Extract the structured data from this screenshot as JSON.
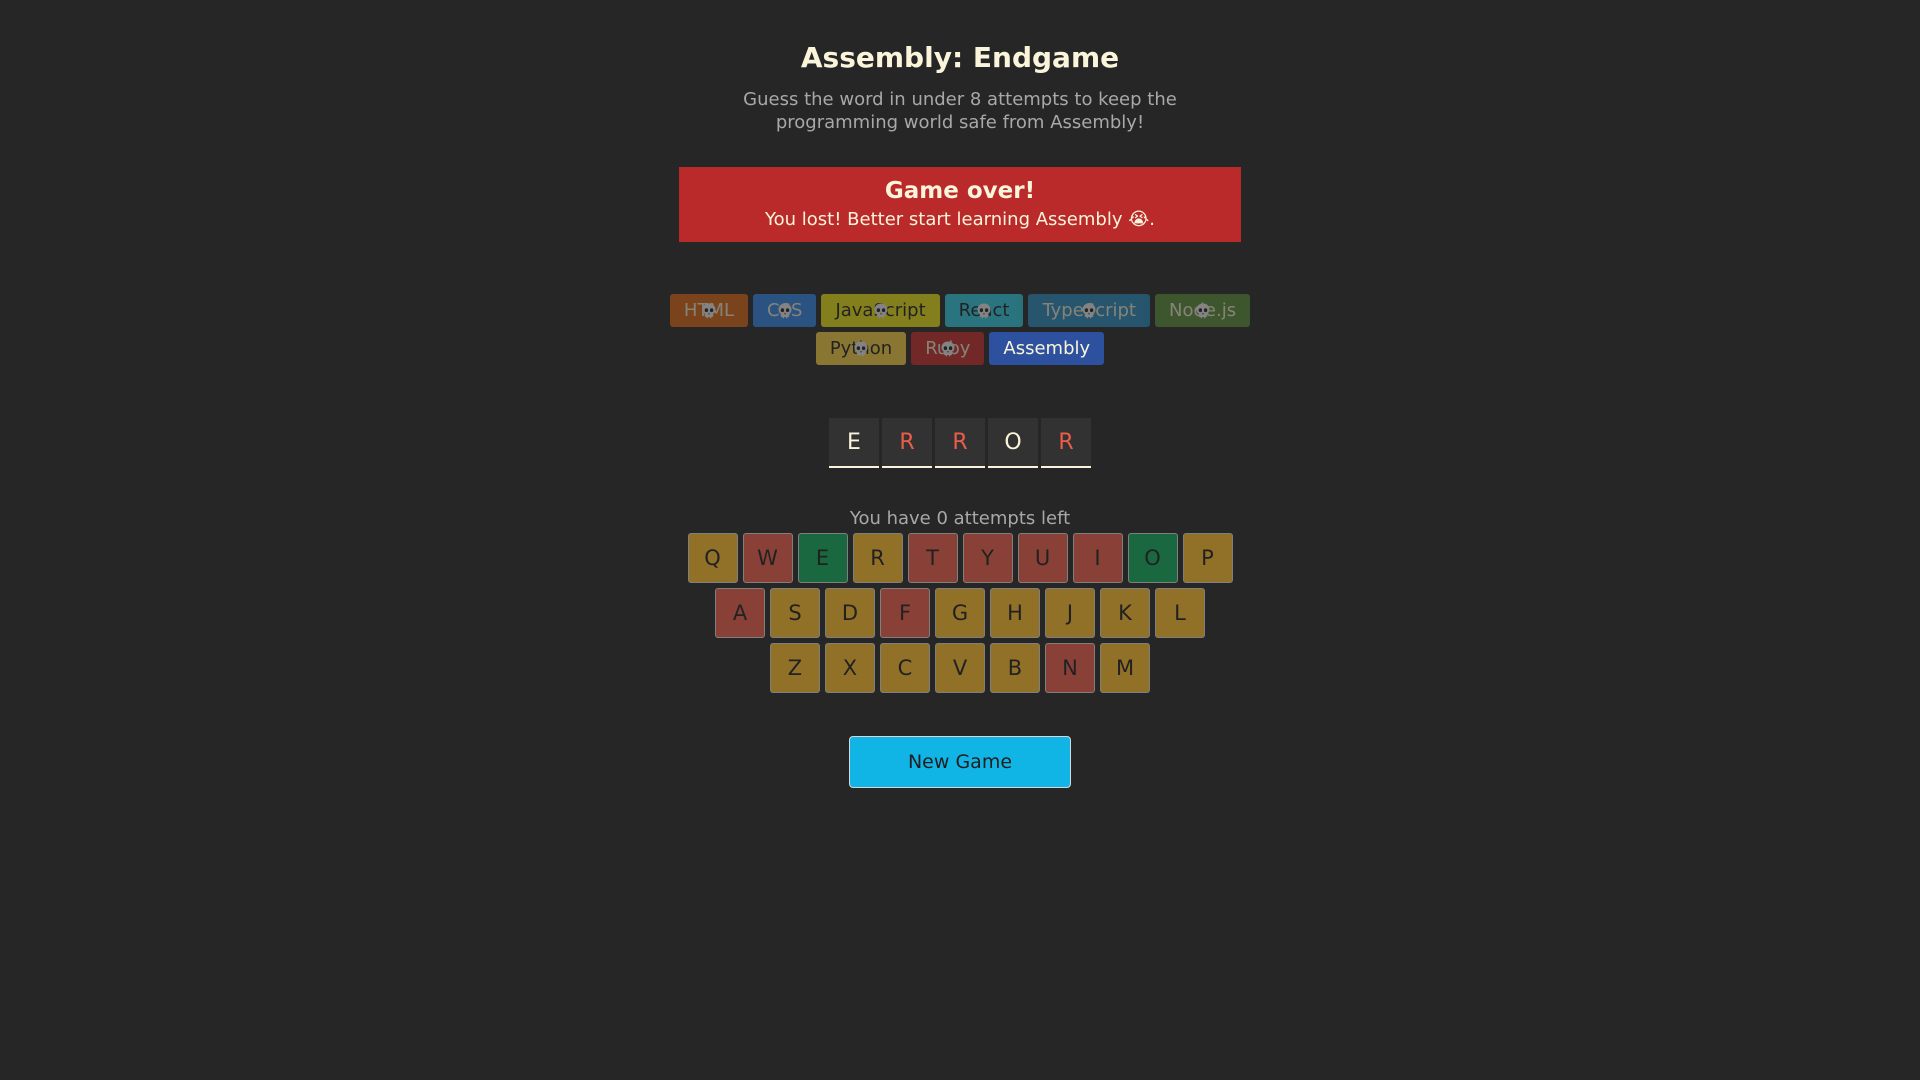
{
  "header": {
    "title": "Assembly: Endgame",
    "subtitle": "Guess the word in under 8 attempts to keep the programming world safe from Assembly!"
  },
  "status": {
    "title": "Game over!",
    "message": "You lost! Better start learning Assembly 😭."
  },
  "languages": [
    {
      "name": "HTML",
      "bg": "#E2680F",
      "color": "#F9F4DA",
      "lost": true
    },
    {
      "name": "CSS",
      "bg": "#328AF1",
      "color": "#F9F4DA",
      "lost": true
    },
    {
      "name": "JavaScript",
      "bg": "#F4EB13",
      "color": "#1E1E1E",
      "lost": true
    },
    {
      "name": "React",
      "bg": "#2ED3E9",
      "color": "#1E1E1E",
      "lost": true
    },
    {
      "name": "TypeScript",
      "bg": "#298EC6",
      "color": "#F9F4DA",
      "lost": true
    },
    {
      "name": "Node.js",
      "bg": "#599137",
      "color": "#F9F4DA",
      "lost": true
    },
    {
      "name": "Python",
      "bg": "#FFD742",
      "color": "#1E1E1E",
      "lost": true
    },
    {
      "name": "Ruby",
      "bg": "#D02B2B",
      "color": "#F9F4DA",
      "lost": true
    },
    {
      "name": "Assembly",
      "bg": "#2D519F",
      "color": "#F9F4DA",
      "lost": false
    }
  ],
  "word": [
    {
      "letter": "E",
      "state": "guessed"
    },
    {
      "letter": "R",
      "state": "missed"
    },
    {
      "letter": "R",
      "state": "missed"
    },
    {
      "letter": "O",
      "state": "guessed"
    },
    {
      "letter": "R",
      "state": "missed"
    }
  ],
  "attempts_text": "You have 0 attempts left",
  "keyboard": {
    "rows": [
      [
        {
          "key": "Q",
          "state": "unused"
        },
        {
          "key": "W",
          "state": "wrong"
        },
        {
          "key": "E",
          "state": "right"
        },
        {
          "key": "R",
          "state": "unused"
        },
        {
          "key": "T",
          "state": "wrong"
        },
        {
          "key": "Y",
          "state": "wrong"
        },
        {
          "key": "U",
          "state": "wrong"
        },
        {
          "key": "I",
          "state": "wrong"
        },
        {
          "key": "O",
          "state": "right"
        },
        {
          "key": "P",
          "state": "unused"
        }
      ],
      [
        {
          "key": "A",
          "state": "wrong"
        },
        {
          "key": "S",
          "state": "unused"
        },
        {
          "key": "D",
          "state": "unused"
        },
        {
          "key": "F",
          "state": "wrong"
        },
        {
          "key": "G",
          "state": "unused"
        },
        {
          "key": "H",
          "state": "unused"
        },
        {
          "key": "J",
          "state": "unused"
        },
        {
          "key": "K",
          "state": "unused"
        },
        {
          "key": "L",
          "state": "unused"
        }
      ],
      [
        {
          "key": "Z",
          "state": "unused"
        },
        {
          "key": "X",
          "state": "unused"
        },
        {
          "key": "C",
          "state": "unused"
        },
        {
          "key": "V",
          "state": "unused"
        },
        {
          "key": "B",
          "state": "unused"
        },
        {
          "key": "N",
          "state": "wrong"
        },
        {
          "key": "M",
          "state": "unused"
        }
      ]
    ]
  },
  "new_game_label": "New Game",
  "colors": {
    "background": "#262626",
    "status_lost": "#BA2A2A",
    "key_unused": "#FCBA29",
    "key_wrong": "#EC5D49",
    "key_right": "#10A95B",
    "new_game": "#11B5E5",
    "missed_letter": "#EC5D49"
  },
  "icons": {
    "lost_language": "skull-icon"
  }
}
